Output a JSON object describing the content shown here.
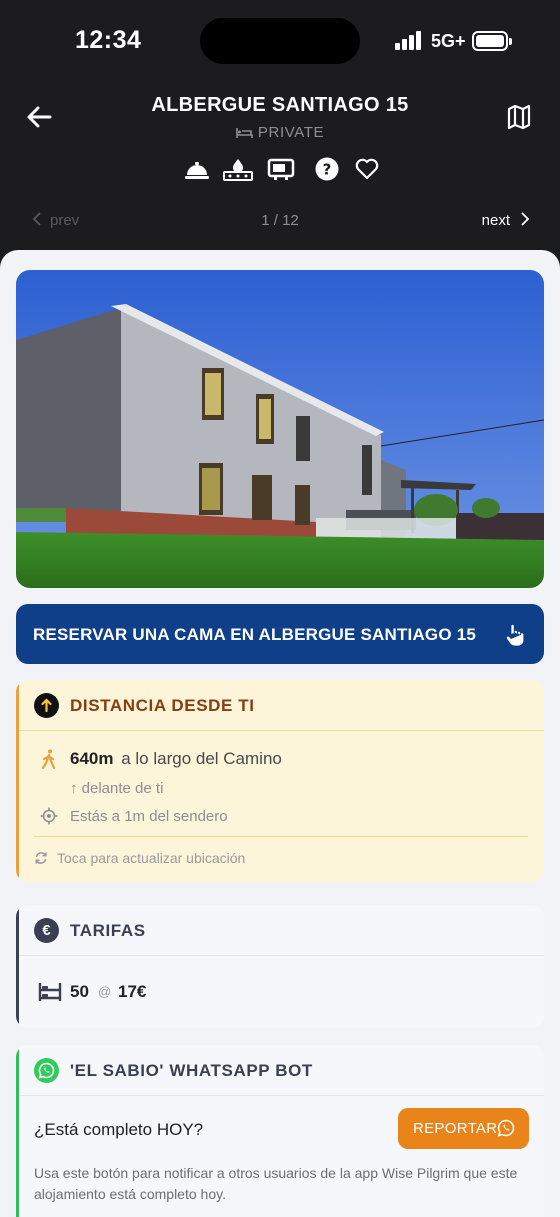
{
  "status_bar": {
    "time": "12:34",
    "network": "5G+",
    "icons": [
      "cellular-signal-icon",
      "battery-icon"
    ]
  },
  "header": {
    "title": "ALBERGUE SANTIAGO 15",
    "subtitle": "PRIVATE",
    "subtitle_icon": "bed-icon",
    "back_icon": "arrow-left-icon",
    "map_icon": "map-icon",
    "amenity_icons": [
      "reception-bell-icon",
      "kitchen-stove-icon",
      "tv-icon",
      "help-icon",
      "favorite-heart-icon"
    ]
  },
  "pager": {
    "prev_label": "prev",
    "count": "1 / 12",
    "next_label": "next"
  },
  "photo": {
    "alt": "Albergue building photo"
  },
  "booking_button": {
    "label": "RESERVAR UNA CAMA EN ALBERGUE SANTIAGO 15",
    "icon": "tap-hand-icon",
    "color": "#0f3f89"
  },
  "distance_card": {
    "title": "DISTANCIA DESDE TI",
    "distance_value": "640m",
    "distance_text": "a lo largo del Camino",
    "ahead_text": "↑ delante de ti",
    "trail_text": "Estás a 1m del sendero",
    "refresh_text": "Toca para actualizar ubicación",
    "accent_color": "#e8a13c"
  },
  "fees_card": {
    "title": "TARIFAS",
    "badge": "€",
    "beds": "50",
    "at": "@",
    "price": "17€"
  },
  "whatsapp_card": {
    "title": "'EL SABIO' WHATSAPP BOT",
    "question": "¿Está completo HOY?",
    "report_label": "REPORTAR",
    "note": "Usa este botón para notificar a otros usuarios de la app Wise Pilgrim que este alojamiento está completo hoy.",
    "accent_color": "#2fbf5a",
    "button_color": "#e8841a"
  }
}
